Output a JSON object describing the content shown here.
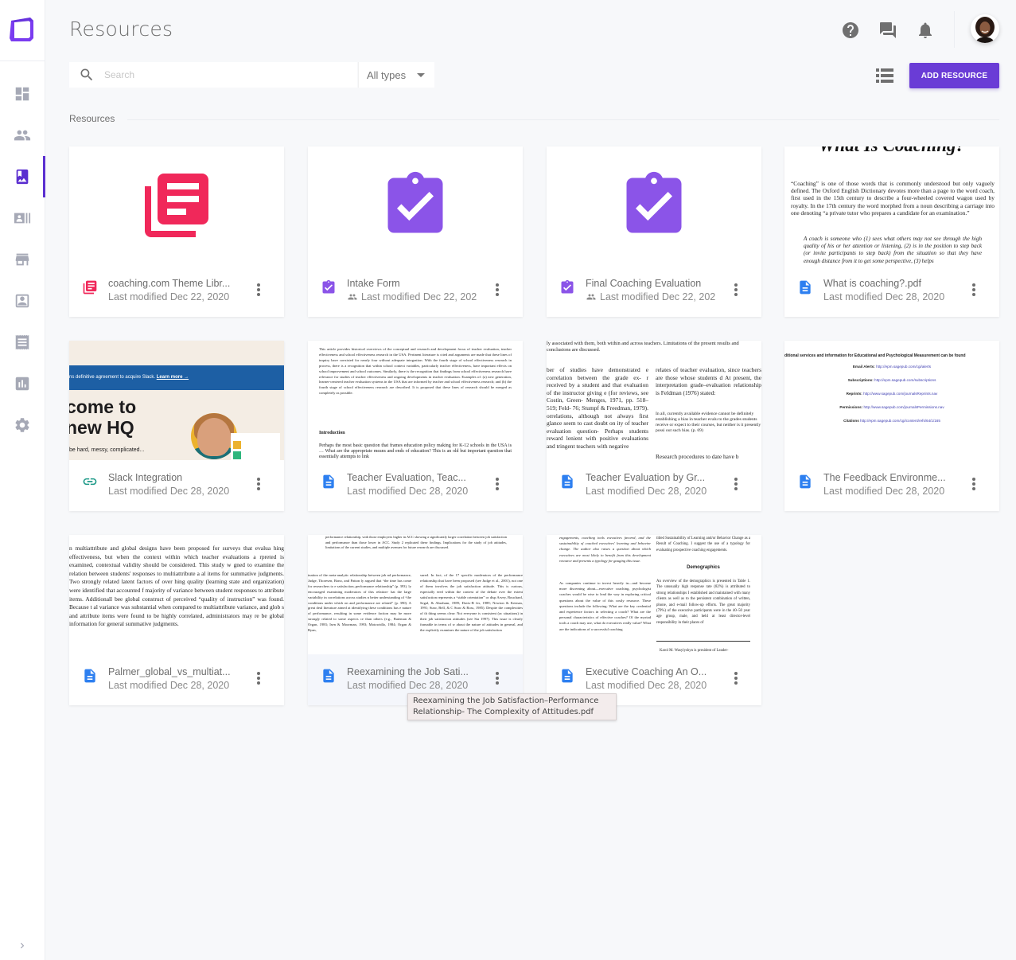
{
  "header": {
    "title": "Resources",
    "icons": [
      "help-icon",
      "chat-icon",
      "notifications-icon",
      "avatar"
    ]
  },
  "sidebar": {
    "items": [
      {
        "name": "dashboard",
        "icon": "dashboard-icon",
        "active": false
      },
      {
        "name": "clients",
        "icon": "people-icon",
        "active": false
      },
      {
        "name": "resources",
        "icon": "photo-album-icon",
        "active": true
      },
      {
        "name": "contacts",
        "icon": "contact-cards-icon",
        "active": false
      },
      {
        "name": "store",
        "icon": "storefront-icon",
        "active": false
      },
      {
        "name": "profile",
        "icon": "portrait-icon",
        "active": false
      },
      {
        "name": "receipts",
        "icon": "receipt-icon",
        "active": false
      },
      {
        "name": "reports",
        "icon": "bar-chart-icon",
        "active": false
      },
      {
        "name": "settings",
        "icon": "gear-icon",
        "active": false
      }
    ],
    "expand_icon": "chevron-right-icon"
  },
  "toolbar": {
    "search_placeholder": "Search",
    "search_value": "",
    "type_filter": "All types",
    "add_button": "ADD RESOURCE",
    "view_toggle": "list-view-icon"
  },
  "section": {
    "label": "Resources"
  },
  "colors": {
    "accent": "#6a3cd6",
    "library": "#f0285a",
    "form": "#8b54e8",
    "doc": "#2d7ff0",
    "link": "#1e9a88"
  },
  "cards": [
    {
      "title": "coaching.com Theme Libr...",
      "meta": "Last modified Dec 22, 2020",
      "type": "library",
      "shared": false
    },
    {
      "title": "Intake Form",
      "meta": "Last modified Dec 22, 202",
      "type": "form",
      "shared": true
    },
    {
      "title": "Final Coaching Evaluation",
      "meta": "Last modified Dec 22, 202",
      "type": "form",
      "shared": true
    },
    {
      "title": "What is coaching?.pdf",
      "meta": "Last modified Dec 28, 2020",
      "type": "pdf",
      "shared": false
    },
    {
      "title": "Slack Integration",
      "meta": "Last modified Dec 28, 2020",
      "type": "link",
      "shared": false
    },
    {
      "title": "Teacher Evaluation, Teac...",
      "meta": "Last modified Dec 28, 2020",
      "type": "pdf",
      "shared": false
    },
    {
      "title": "Teacher Evaluation by Gr...",
      "meta": "Last modified Dec 28, 2020",
      "type": "pdf",
      "shared": false
    },
    {
      "title": "The Feedback Environme...",
      "meta": "Last modified Dec 28, 2020",
      "type": "pdf",
      "shared": false
    },
    {
      "title": "Palmer_global_vs_multiat...",
      "meta": "Last modified Dec 28, 2020",
      "type": "pdf",
      "shared": false
    },
    {
      "title": "Reexamining the Job Sati...",
      "meta": "Last modified Dec 28, 2020",
      "type": "pdf",
      "shared": false
    },
    {
      "title": "Executive Coaching An O...",
      "meta": "Last modified Dec 28, 2020",
      "type": "pdf",
      "shared": false
    }
  ],
  "previews": {
    "what_is_coaching": {
      "heading": "What Is Coaching?",
      "p1": "“Coaching” is one of those words that is commonly understood but only vaguely defined. The Oxford English Dictionary devotes more than a page to the word coach, first used in the 15th century to describe a four-wheeled covered wagon used by royalty. In the 17th century the word morphed from a noun describing a carriage into one denoting “a private tutor who prepares a candidate for an examination.”",
      "p2": "A coach is someone who (1) sees what others may not see through the high quality of his or her attention or listening, (2) is in the position to step back (or invite participants to step back) from the situation so that they have enough distance from it to get some perspective, (3) helps"
    },
    "slack": {
      "banner": "ns definitive agreement to acquire Slack.",
      "banner_link": "Learn more →",
      "headline1": "come to",
      "headline2": "new HQ",
      "sub": "be hard, messy, complicated..."
    },
    "teacher_eval": {
      "abstract": "This article provides historical overviews of the conceptual and research and development focus of teacher evaluation, teacher effectiveness and school effectiveness research in the USA. Pertinent literature is cited and arguments are made that these lines of inquiry have coexisted for nearly four without adequate integration. With the fourth stage of school effectiveness research in process, there is a recognition that within school context variables, particularly teacher effectiveness, have important effects on school improvement and school outcomes. Similarly, there is the recognition that findings from school effectiveness research have relevance for studies of teacher effectiveness and ongoing developments in teacher evaluation. Examples of: (a) new generation, learner-centered teacher evaluation systems in the USA that are informed by teacher and school effectiveness research; and (b) the fourth stage of school effectiveness research are described. It is proposed that these lines of research should be merged as completely as possible.",
      "intro_heading": "Introduction",
      "intro": "Perhaps the most basic question that frames education policy making for K-12 schools in the USA is … What are the appropriate means and ends of education? This is an old but important question that essentially attempts to link"
    },
    "teacher_eval_grade": {
      "top": "ly associated with them, both within and across teachers. Limitations of the present results and conclusions are discussed.",
      "col1": "ber of studies have demonstrated e correlation between the grade ex- r received by a student and that evaluation of the instructor giving e (for reviews, see Costin, Green- Menges, 1971, pp. 518–519; Feld- 76; Stumpf & Freedman, 1979). orrelations, although not always first glance seem to cast doubt on ity of teacher evaluation question- Perhaps students reward lenient with positive evaluations and tringent teachers with negative",
      "col2a": "relates of teacher evaluation, since teachers are those whose students d At present, the interpretation grade–evaluation relationship is Feldman (1976) stated:",
      "col2b": "In all, currently available evidence cannot be definitely establishing a bias in teacher evalu to the grades students receive or expect to their courses, but neither is it presently possi out such bias. (p. 69)",
      "col2c": "Research procedures to date have b"
    },
    "feedback_env": {
      "line0": "ditional services and information for Educational and Psychological Measurement can be found",
      "rows": [
        {
          "label": "Email Alerts:",
          "url": "http://epm.sagepub.com/cgi/alerts"
        },
        {
          "label": "Subscriptions:",
          "url": "http://epm.sagepub.com/subscriptions"
        },
        {
          "label": "Reprints:",
          "url": "http://www.sagepub.com/journalsReprints.nav"
        },
        {
          "label": "Permissions:",
          "url": "http://www.sagepub.com/journalsPermissions.nav"
        },
        {
          "label": "Citations",
          "url": "http://epm.sagepub.com/cgi/content/refs/64/1/165"
        }
      ]
    },
    "palmer": {
      "text": "n multiattribute and global designs have been proposed for surveys that evalua hing effectiveness, but when the context within which teacher evaluations a rpreted is examined, contextual validity should be considered. This study w gned to examine the relation between students' responses to multiattribute a al items for summative judgments. Two strongly related latent factors of over hing quality (learning state and organization) were identified that accounted f majority of variance between student responses to attribute items. Additionall bee global construct of perceived “quality of instruction” was found. Because t al variance was substantial when compared to multiattribute variance, and glob s and attribute items were found to be highly correlated, administrators may re be global information for general summative judgments."
    },
    "reexamining": {
      "top": "performance relationship, with those employees higher in ACC showing a significantly larger correlation between job satisfaction and performance than those lower in ACC. Study 2 replicated these findings. Implications for the study of job attitudes, limitations of the current studies, and multiple avenues for future research are discussed.",
      "col1": "ination of the meta-analytic relationship between job nd performance, Judge, Thoresen, Bono, and Patton ly argued that “the time has come for researchers to e satisfaction–performance relationship” (p. 393). ly encouraged examining moderators of this relation- hat the large variability in correlations across studies n better understanding of “the conditions under which on and performance are related” (p. 390). A great deal literature aimed at identifying these conditions has e nature of performance, resulting in some evidence faction may be more strongly related to some aspects ce than others (e.g., Bateman & Organ, 1983; Isen & Moorman, 1993; Motowidlo, 1984; Organ & Ryan,",
      "col2": "sured. In fact, of the 17 specific moderators of the performance relationship that have been proposed (see Judge et al., 2001), not one of them involves the job satisfaction attitude. This is curious, especially ered within the context of the debate over the extent satisfaction represents a “stable orientation” or disp Arvey, Bouchard, Segal, & Abraham, 1989; Davis-B fer, 1989; Newton & Keenan, 1991; Staw, Bell, & C Staw & Ross, 1985). Despite the complexities of th thing seems clear: Not everyone is consistent (ac situations) in their job satisfaction attitudes (see Sta 1997). This issue is clearly framable in terms of w about the nature of attitudes in general, and the explicitly examines the nature of the job satisfaction"
    },
    "executive": {
      "col1a": "engagements, coaching tools executives favored, and the sustainability of coached executives' learning and behavior change. The author also raises a question about which executives are most likely to benefit from this development resource and presents a typology for gauging this issue.",
      "col1b": "As companies continue to invest heavily in—and become more discerning about—executive coaching, psychologist coaches would be wise to lead the way in exploring critical questions about the value of this costly resource. These questions include the following: What are the key credential and experience factors in selecting a coach? What are the personal characteristics of effective coaches? Of the myriad tools a coach may use, what do executives really value? What are the indications of a successful coaching",
      "col2a": "titled Sustainability of Learning and/or Behavior Change as a Result of Coaching. I suggest the use of a typology for evaluating prospective coaching engagements.",
      "col2_heading": "Demographics",
      "col2b": "An overview of the demographics is presented in Table 1. The unusually high response rate (82%) is attributed to strong relationships I established and maintained with many clients as well as to the persistent combination of written, phone, and e-mail follow-up efforts. The great majority (79%) of the executive participants were in the 40–50 year age group, male, and held at least director-level responsibility in their places of",
      "col2c": "Karol M. Wasylyshyn is president of Leader-"
    }
  },
  "tooltip": {
    "text": "Reexamining the Job Satisfaction–Performance Relationship- The Complexity of Attitudes.pdf"
  }
}
